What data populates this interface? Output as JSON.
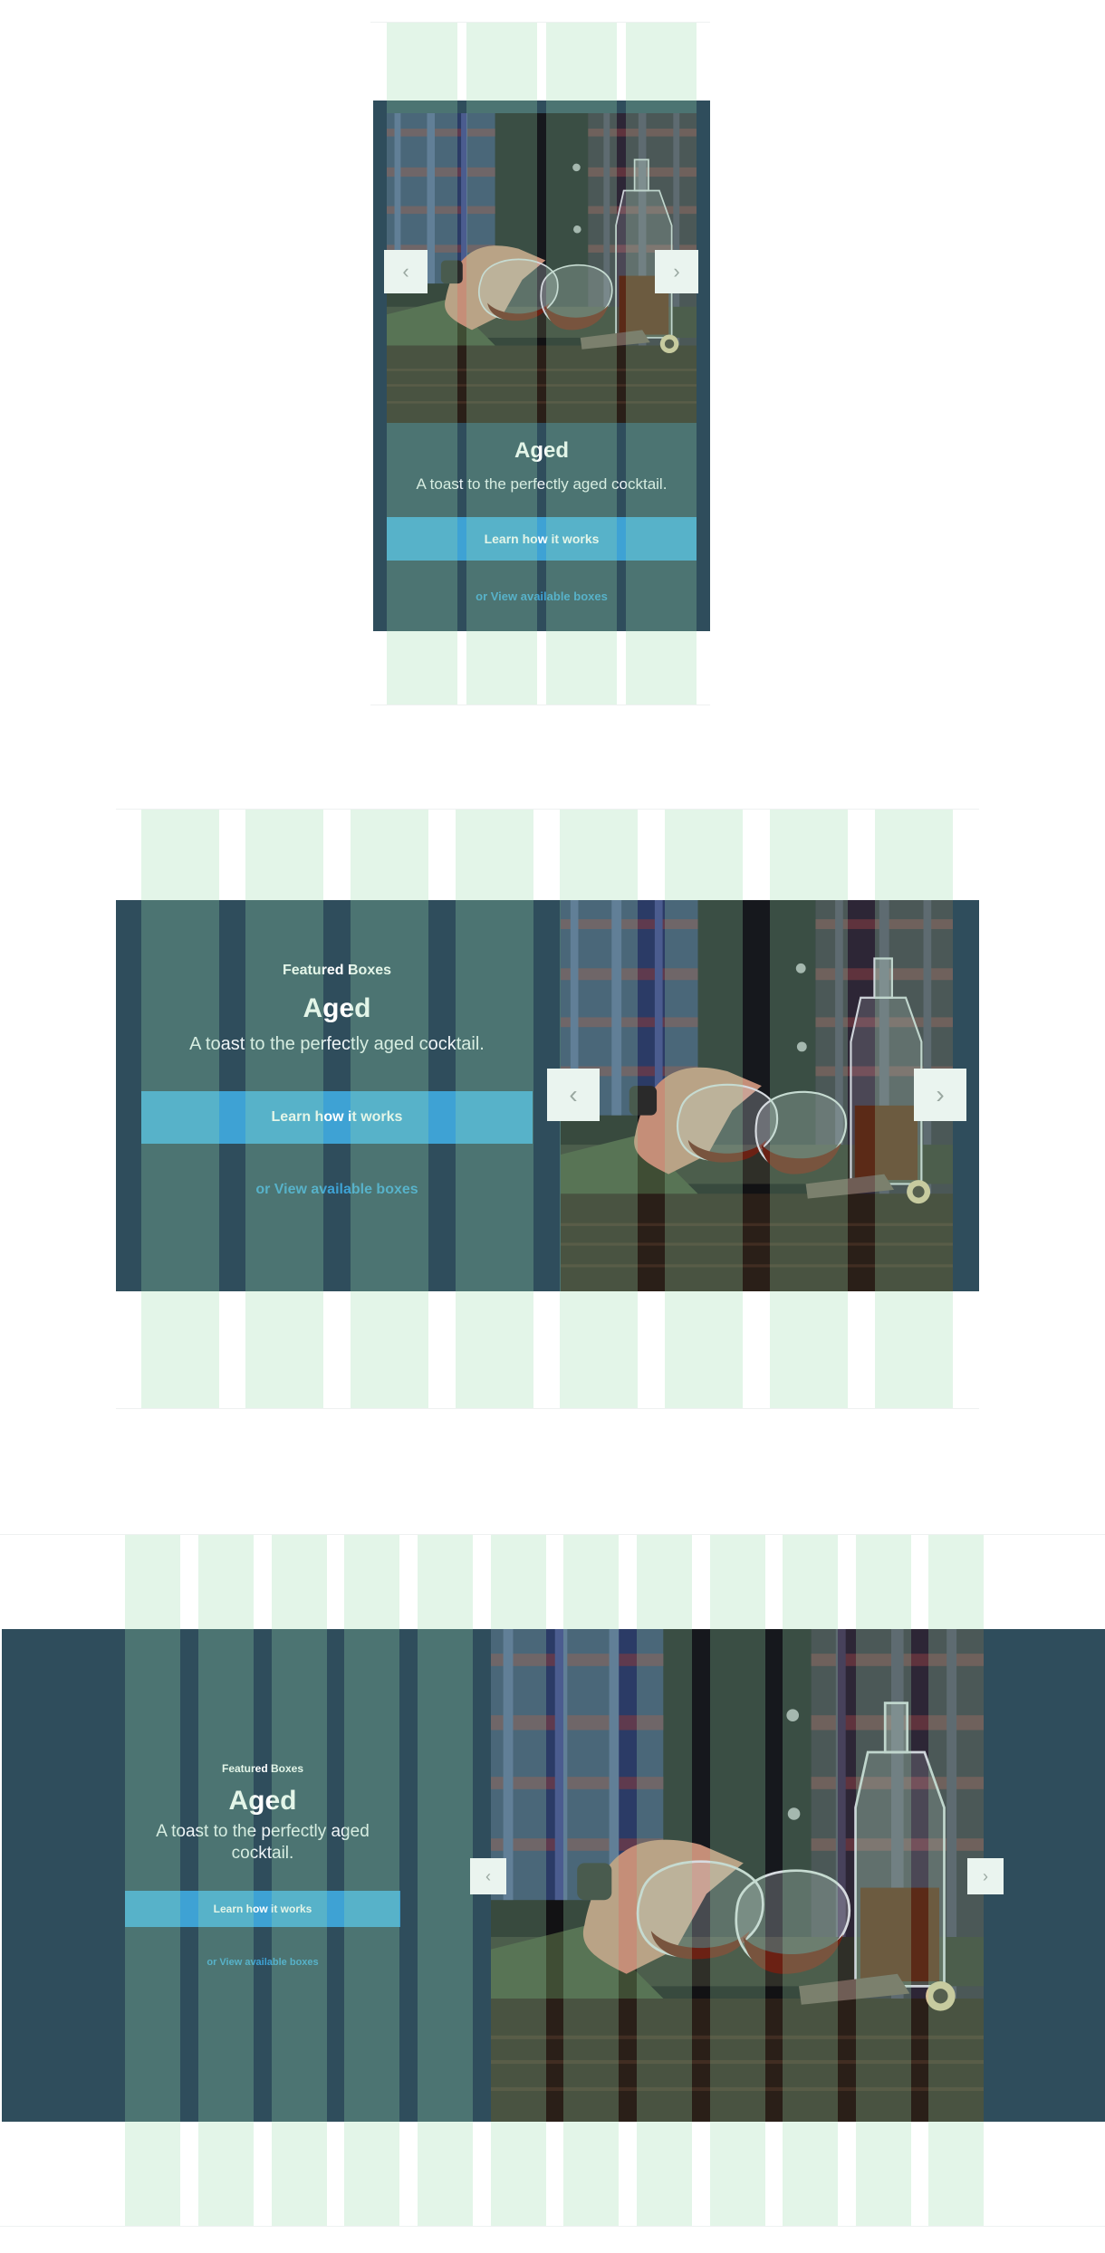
{
  "colors": {
    "card_background": "#2f4d5c",
    "cta_background": "#3ea2d4",
    "link": "#3ea2d4",
    "grid_overlay": "#99dbad",
    "arrow_background": "#eaf4ef"
  },
  "icons": {
    "prev": "chevron-left-icon",
    "next": "chevron-right-icon"
  },
  "variants": {
    "mobile": {
      "headline": "Aged",
      "subline": "A toast to the perfectly aged cocktail.",
      "cta_label": "Learn how it works",
      "link_label": "or View available boxes"
    },
    "tablet": {
      "eyebrow": "Featured Boxes",
      "headline": "Aged",
      "subline": "A toast to the perfectly aged cocktail.",
      "cta_label": "Learn how it works",
      "link_label": "or View available boxes"
    },
    "desktop": {
      "eyebrow": "Featured Boxes",
      "headline": "Aged",
      "subline": "A toast to the perfectly aged cocktail.",
      "cta_label": "Learn how it works",
      "link_label": "or View available boxes"
    }
  }
}
